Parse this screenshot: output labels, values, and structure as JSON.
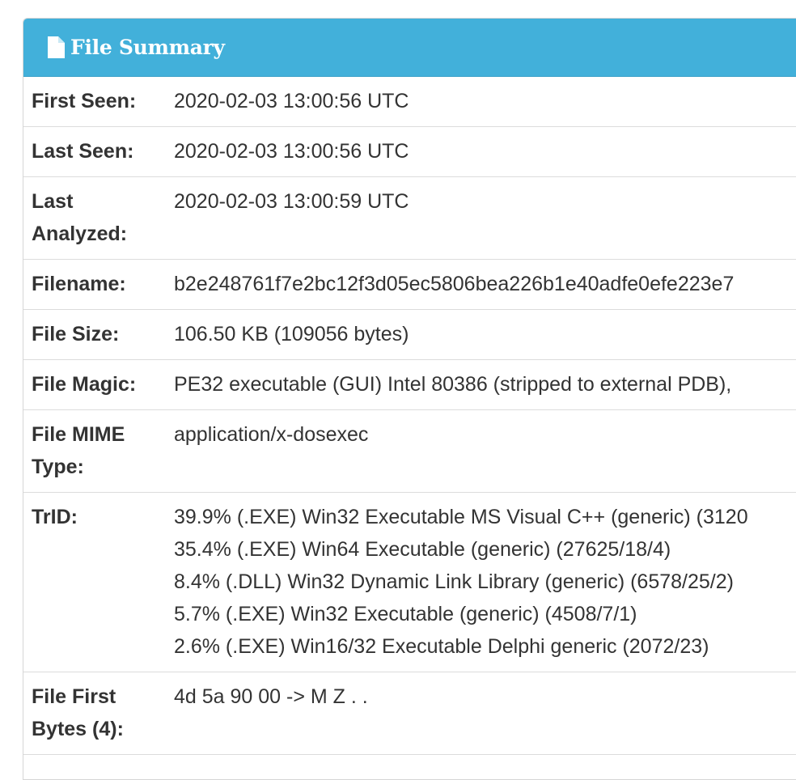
{
  "panel": {
    "title": "File Summary",
    "icon": "file-icon",
    "header_color": "#42b0da"
  },
  "rows": {
    "first_seen": {
      "label": "First Seen:",
      "value": "2020-02-03 13:00:56 UTC"
    },
    "last_seen": {
      "label": "Last Seen:",
      "value": "2020-02-03 13:00:56 UTC"
    },
    "last_analyzed": {
      "label_line1": "Last",
      "label_line2": "Analyzed:",
      "value": "2020-02-03 13:00:59 UTC"
    },
    "filename": {
      "label": "Filename:",
      "value": "b2e248761f7e2bc12f3d05ec5806bea226b1e40adfe0efe223e7"
    },
    "file_size": {
      "label": "File Size:",
      "value": "106.50 KB (109056 bytes)"
    },
    "file_magic": {
      "label": "File Magic:",
      "value": "PE32 executable (GUI) Intel 80386 (stripped to external PDB),"
    },
    "file_mime": {
      "label_line1": "File MIME",
      "label_line2": "Type:",
      "value": "application/x-dosexec"
    },
    "trid": {
      "label": "TrID:",
      "lines": [
        "39.9% (.EXE) Win32 Executable MS Visual C++ (generic) (3120",
        "35.4% (.EXE) Win64 Executable (generic) (27625/18/4)",
        "8.4% (.DLL) Win32 Dynamic Link Library (generic) (6578/25/2)",
        "5.7% (.EXE) Win32 Executable (generic) (4508/7/1)",
        "2.6% (.EXE) Win16/32 Executable Delphi generic (2072/23)"
      ]
    },
    "first_bytes": {
      "label_line1": "File First",
      "label_line2": "Bytes (4):",
      "value": "4d 5a 90 00 -> M Z . ."
    }
  }
}
